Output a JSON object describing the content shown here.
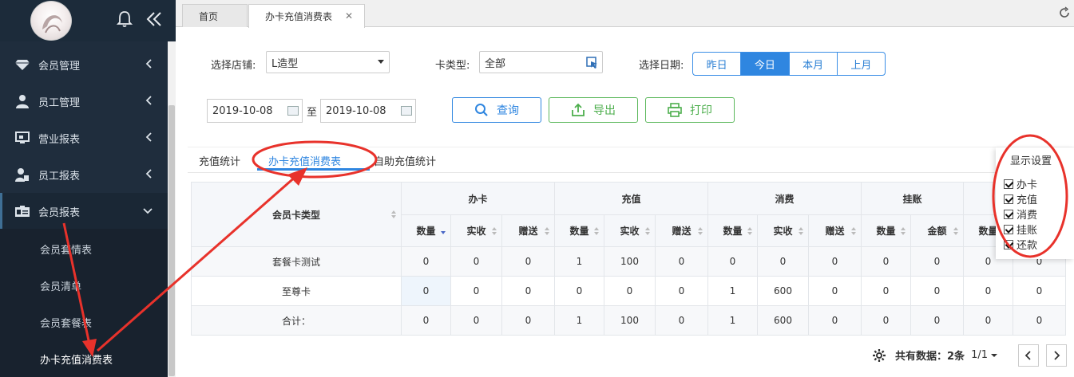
{
  "sidebar": {
    "menu": [
      {
        "label": "会员管理",
        "icon": "diamond-icon"
      },
      {
        "label": "员工管理",
        "icon": "user-icon"
      },
      {
        "label": "营业报表",
        "icon": "monitor-icon"
      },
      {
        "label": "员工报表",
        "icon": "user-badge-icon"
      },
      {
        "label": "会员报表",
        "icon": "id-card-icon"
      }
    ],
    "submenu": [
      "会员套情表",
      "会员清单",
      "会员套餐表",
      "办卡充值消费表"
    ]
  },
  "tabs": [
    {
      "label": "首页"
    },
    {
      "label": "办卡充值消费表",
      "close": "✕"
    }
  ],
  "filters": {
    "store_label": "选择店铺:",
    "store_value": "L造型",
    "card_type_label": "卡类型:",
    "card_type_value": "全部",
    "date_label": "选择日期:",
    "date_options": [
      "昨日",
      "今日",
      "本月",
      "上月"
    ],
    "date_selected": "今日",
    "date_from": "2019-10-08",
    "date_sep": "至",
    "date_to": "2019-10-08"
  },
  "buttons": {
    "query": "查询",
    "export": "导出",
    "print": "打印"
  },
  "inner_tabs": [
    "充值统计",
    "办卡充值消费表",
    "自助充值统计"
  ],
  "table": {
    "first_header": "会员卡类型",
    "groups": [
      "办卡",
      "充值",
      "消费",
      "挂账"
    ],
    "subheaders": [
      "数量",
      "实收",
      "赠送",
      "数量",
      "实收",
      "赠送",
      "数量",
      "实收",
      "赠送",
      "数量",
      "金额",
      "数量",
      ""
    ],
    "rows": [
      {
        "name": "套餐卡测试",
        "cells": [
          "0",
          "0",
          "0",
          "1",
          "100",
          "0",
          "0",
          "0",
          "0",
          "0",
          "0",
          "0",
          "0"
        ]
      },
      {
        "name": "至尊卡",
        "cells": [
          "0",
          "0",
          "0",
          "0",
          "0",
          "0",
          "1",
          "600",
          "0",
          "0",
          "0",
          "0",
          "0"
        ]
      },
      {
        "name": "合计：",
        "cells": [
          "0",
          "0",
          "0",
          "1",
          "100",
          "0",
          "1",
          "600",
          "0",
          "0",
          "0",
          "0",
          "0"
        ]
      }
    ]
  },
  "display_settings": {
    "title": "显示设置",
    "options": [
      "办卡",
      "充值",
      "消费",
      "挂账",
      "还款"
    ]
  },
  "pager": {
    "label": "共有数据：",
    "count": "2条",
    "page": "1/1"
  },
  "colors": {
    "sidebar": "#1f2d3d",
    "accent": "#2f86e0",
    "success": "#5cb85c",
    "annotation": "#e8322b"
  }
}
